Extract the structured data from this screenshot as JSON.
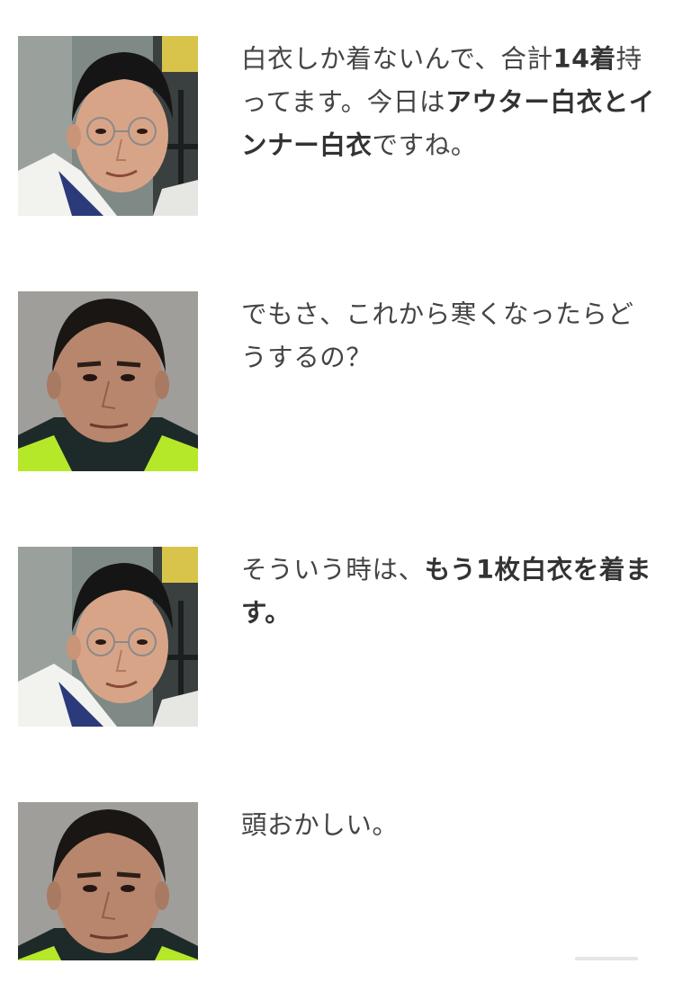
{
  "messages": [
    {
      "speaker": "lab-coat-man",
      "segments": [
        {
          "text": "白衣しか着ないんで、合計",
          "bold": false
        },
        {
          "text": "14着",
          "bold": true
        },
        {
          "text": "持ってます。今日は",
          "bold": false
        },
        {
          "text": "アウター白衣とインナー白衣",
          "bold": true
        },
        {
          "text": "ですね。",
          "bold": false
        }
      ]
    },
    {
      "speaker": "interviewer-man",
      "segments": [
        {
          "text": "でもさ、これから寒くなったらどうするの？",
          "bold": false
        }
      ]
    },
    {
      "speaker": "lab-coat-man",
      "segments": [
        {
          "text": "そういう時は、",
          "bold": false
        },
        {
          "text": "もう1枚白衣を着ます。",
          "bold": true
        }
      ]
    },
    {
      "speaker": "interviewer-man",
      "segments": [
        {
          "text": "頭おかしい。",
          "bold": false
        }
      ]
    }
  ],
  "colors": {
    "text": "#444444",
    "bold_text": "#333333",
    "background": "#ffffff",
    "jacket_accent": "#b6e82a"
  }
}
